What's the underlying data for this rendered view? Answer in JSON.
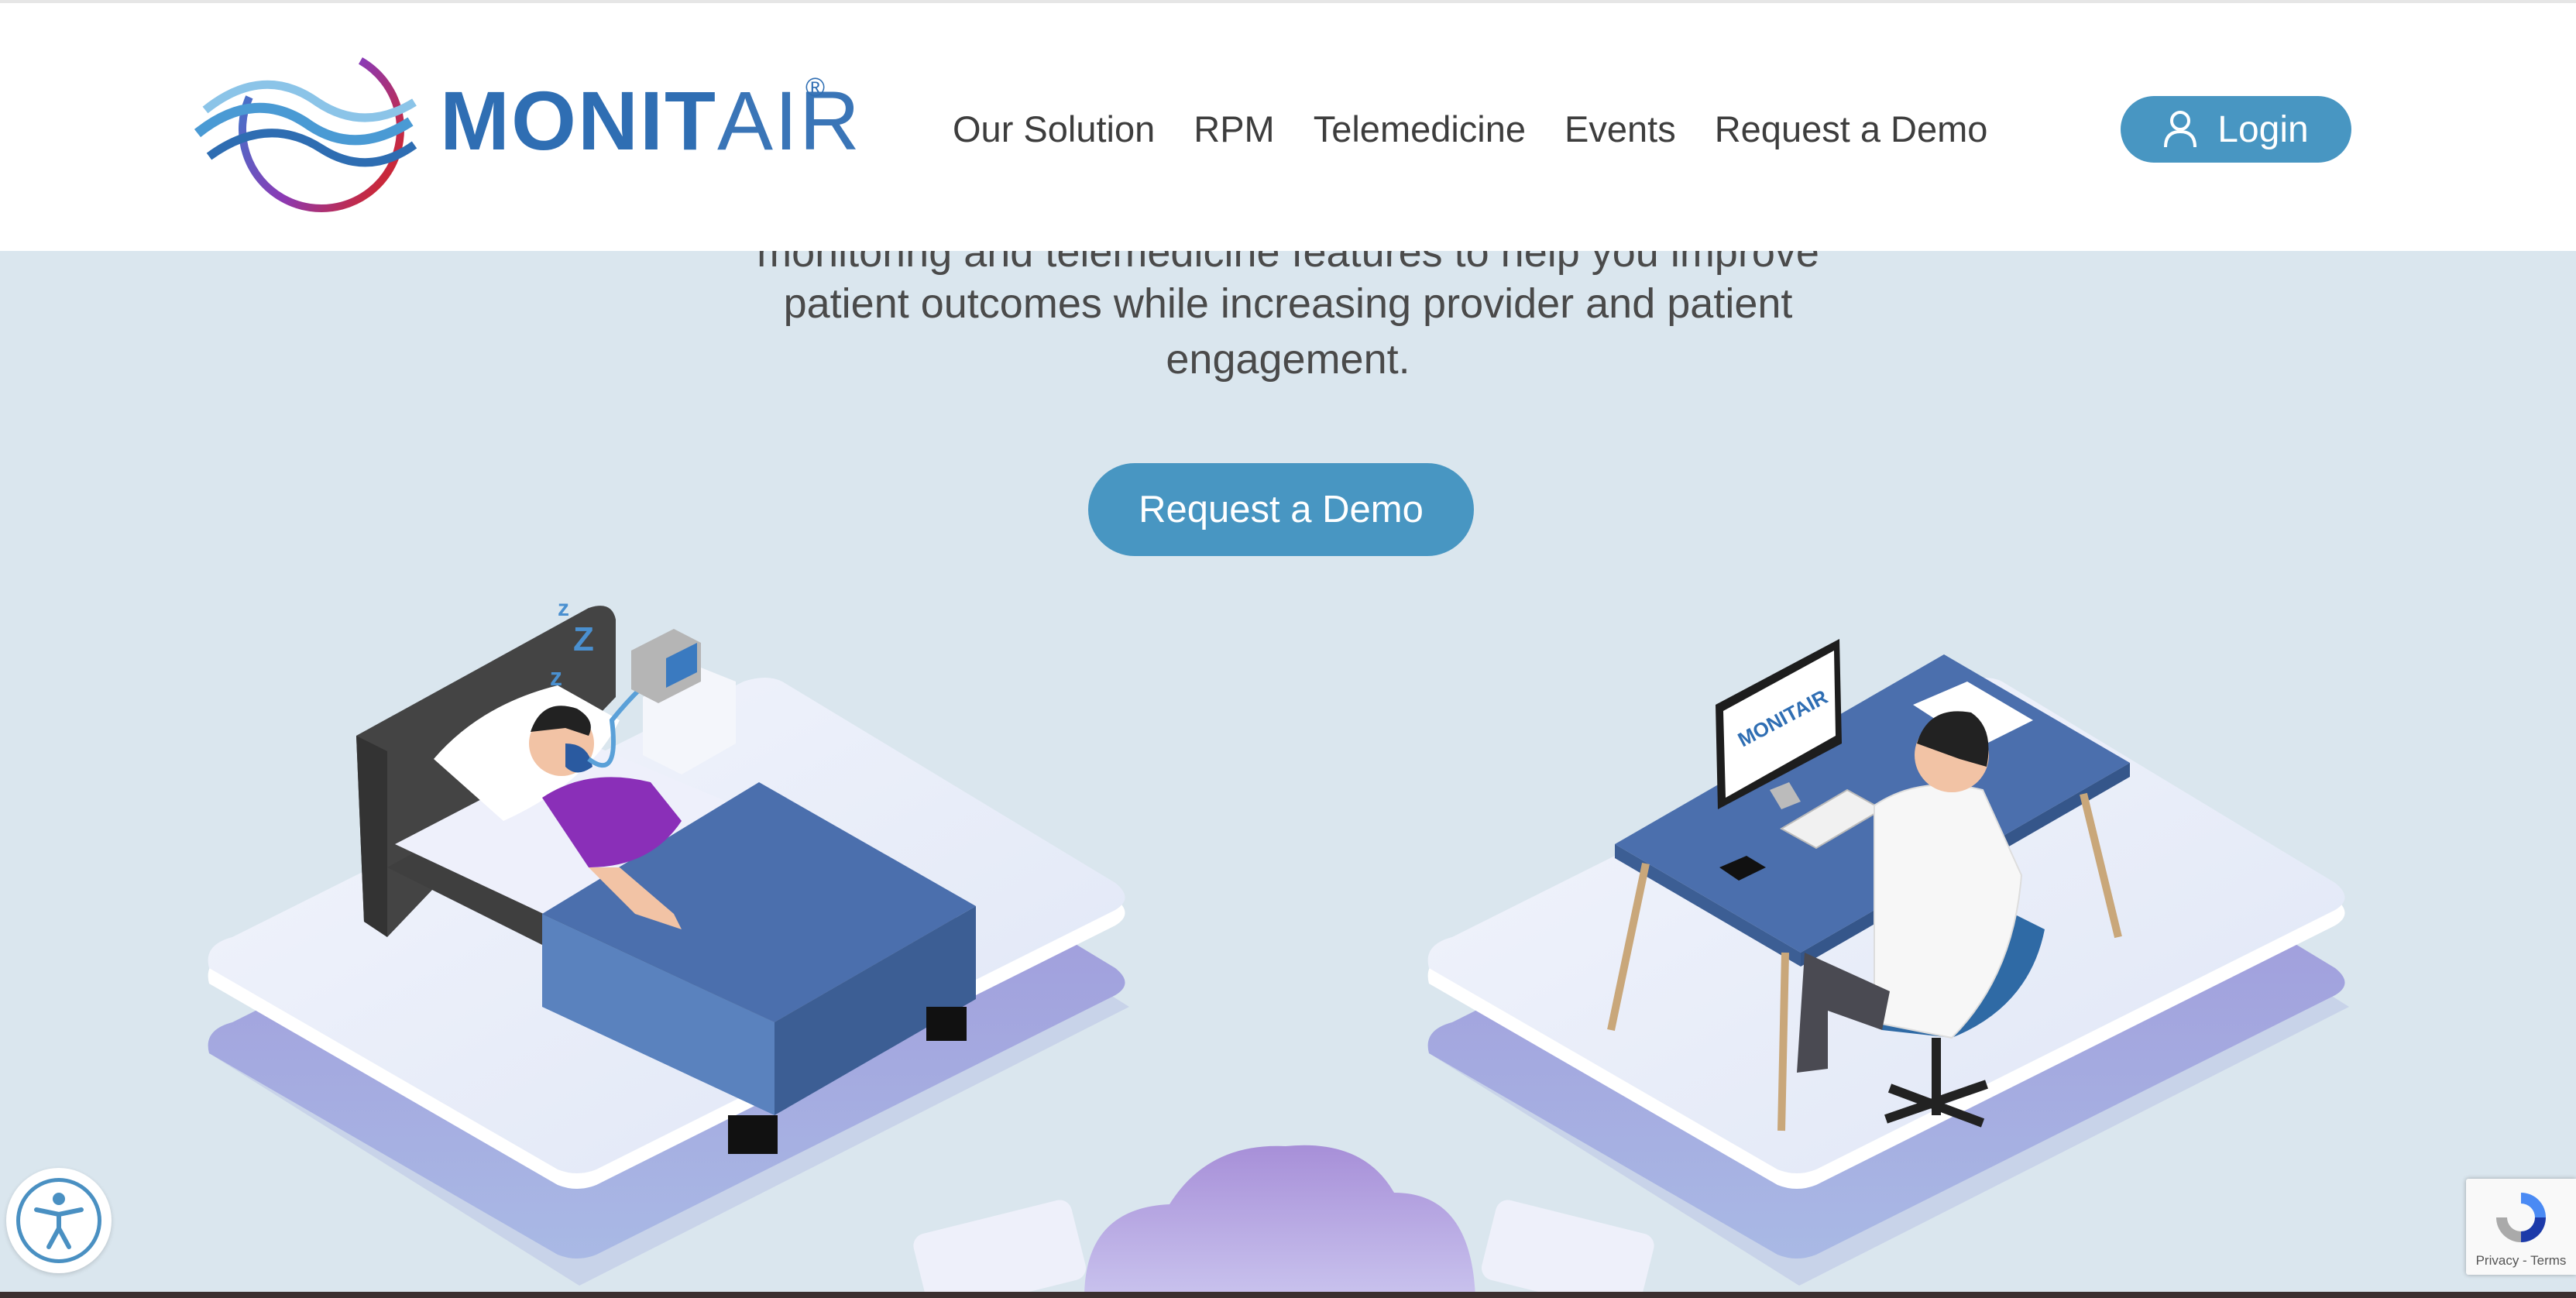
{
  "brand": {
    "name_bold": "MONIT",
    "name_light": "AIR",
    "registered": "®"
  },
  "nav": {
    "items": [
      {
        "label": "Our Solution"
      },
      {
        "label": "RPM"
      },
      {
        "label": "Telemedicine"
      },
      {
        "label": "Events"
      },
      {
        "label": "Request a Demo"
      }
    ],
    "login_label": "Login"
  },
  "hero": {
    "partial_line": "monitoring and telemedicine features to help you improve",
    "lines": [
      "patient outcomes while increasing provider and patient",
      "engagement."
    ],
    "cta_label": "Request a Demo"
  },
  "illustration": {
    "monitor_brand": "MONITAIR"
  },
  "recaptcha": {
    "links": "Privacy - Terms"
  },
  "colors": {
    "accent": "#4896c2",
    "brand_blue": "#2f6eb3",
    "background": "#dae6ee",
    "bed_blue": "#4b6fad",
    "shirt_purple": "#8a2fb8"
  },
  "icons": {
    "login": "user-icon",
    "accessibility": "accessibility-icon",
    "recaptcha": "recaptcha-icon"
  }
}
